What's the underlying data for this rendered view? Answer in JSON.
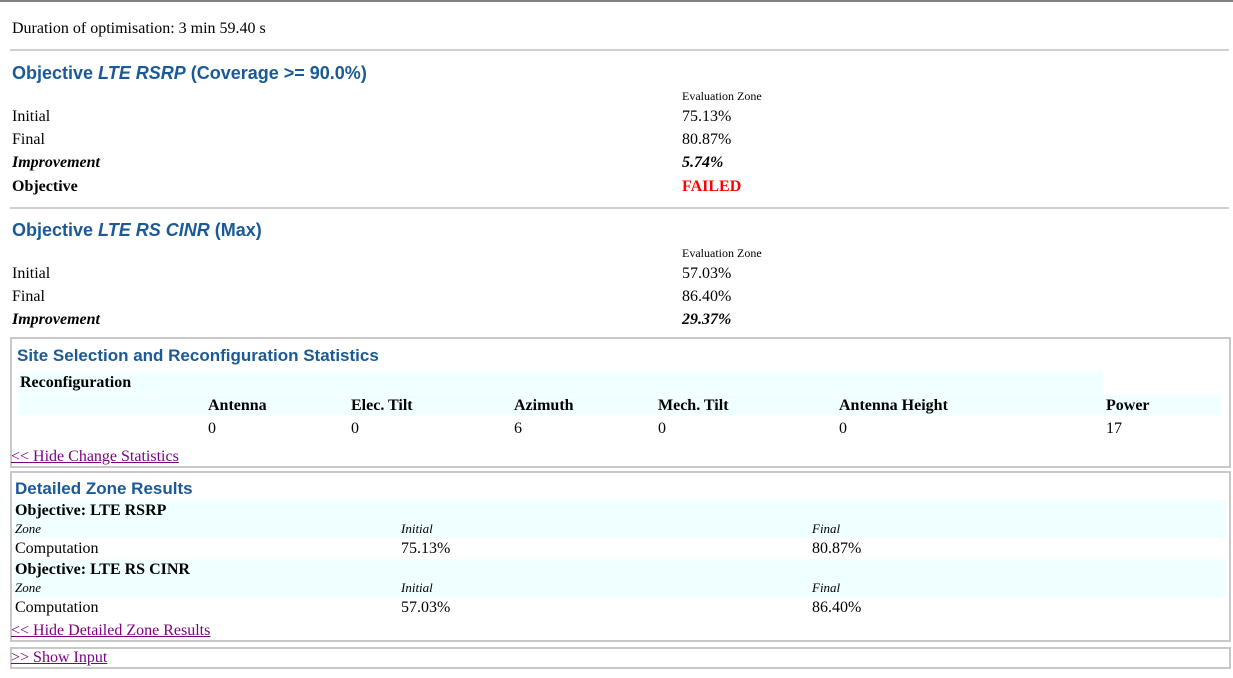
{
  "duration": "Duration of optimisation: 3 min 59.40 s",
  "objectives": [
    {
      "prefix": "Objective ",
      "name": "LTE RSRP",
      "suffix": " (Coverage >= 90.0%)",
      "zone_header": "Evaluation Zone",
      "rows": [
        {
          "label": "Initial",
          "value": "75.13%"
        },
        {
          "label": "Final",
          "value": "80.87%"
        },
        {
          "label": "Improvement",
          "value": "5.74%"
        },
        {
          "label": "Objective",
          "value": "FAILED"
        }
      ]
    },
    {
      "prefix": "Objective ",
      "name": "LTE RS CINR",
      "suffix": " (Max)",
      "zone_header": "Evaluation Zone",
      "rows": [
        {
          "label": "Initial",
          "value": "57.03%"
        },
        {
          "label": "Final",
          "value": "86.40%"
        },
        {
          "label": "Improvement",
          "value": "29.37%"
        }
      ]
    }
  ],
  "site_stats": {
    "title": "Site Selection and Reconfiguration Statistics",
    "subtitle": "Reconfiguration",
    "columns": [
      "Antenna",
      "Elec. Tilt",
      "Azimuth",
      "Mech. Tilt",
      "Antenna Height",
      "Power"
    ],
    "values": [
      "0",
      "0",
      "6",
      "0",
      "0",
      "17"
    ],
    "hide_link": "<< Hide Change Statistics"
  },
  "zone_results": {
    "title": "Detailed Zone Results",
    "groups": [
      {
        "objective": "Objective: LTE RSRP",
        "zone_label": "Zone",
        "initial_label": "Initial",
        "final_label": "Final",
        "zone": "Computation",
        "initial": "75.13%",
        "final": "80.87%"
      },
      {
        "objective": "Objective: LTE RS CINR",
        "zone_label": "Zone",
        "initial_label": "Initial",
        "final_label": "Final",
        "zone": "Computation",
        "initial": "57.03%",
        "final": "86.40%"
      }
    ],
    "hide_link": "<< Hide Detailed Zone Results"
  },
  "show_input_link": ">> Show Input"
}
